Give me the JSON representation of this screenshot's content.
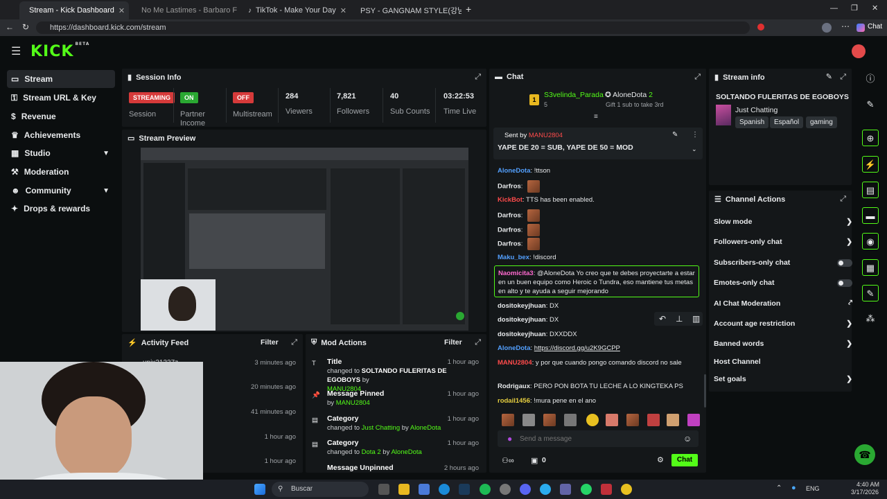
{
  "browser": {
    "tabs": [
      {
        "label": "Stream - Kick Dashboard",
        "active": true
      },
      {
        "label": "No Me Lastimes - Barbaro Fines y"
      },
      {
        "label": "TikTok - Make Your Day"
      },
      {
        "label": "PSY - GANGNAM STYLE(강남스타"
      }
    ],
    "url": "https://dashboard.kick.com/stream",
    "chat_label": "Chat"
  },
  "brand": {
    "logo": "KICK",
    "beta": "BETA",
    "accent": "#53fc18"
  },
  "sidebar": {
    "items": [
      {
        "label": "Stream",
        "icon": "stream-icon"
      },
      {
        "label": "Stream URL & Key",
        "icon": "key-icon"
      },
      {
        "label": "Revenue",
        "icon": "dollar-icon"
      },
      {
        "label": "Achievements",
        "icon": "trophy-icon"
      },
      {
        "label": "Studio",
        "icon": "studio-icon"
      },
      {
        "label": "Moderation",
        "icon": "gavel-icon"
      },
      {
        "label": "Community",
        "icon": "people-icon"
      },
      {
        "label": "Drops & rewards",
        "icon": "gift-icon"
      }
    ]
  },
  "session": {
    "title": "Session Info",
    "stats": [
      {
        "value": "STREAMING",
        "label": "Session"
      },
      {
        "value": "ON",
        "label": "Partner Income"
      },
      {
        "value": "OFF",
        "label": "Multistream"
      },
      {
        "value": "284",
        "label": "Viewers"
      },
      {
        "value": "7,821",
        "label": "Followers"
      },
      {
        "value": "40",
        "label": "Sub Counts"
      },
      {
        "value": "03:22:53",
        "label": "Time Live"
      }
    ]
  },
  "preview": {
    "title": "Stream Preview"
  },
  "activity": {
    "title": "Activity Feed",
    "filter": "Filter",
    "items": [
      {
        "user": "unix21337z",
        "time": "3 minutes ago"
      },
      {
        "time": "20 minutes ago"
      },
      {
        "time": "41 minutes ago"
      },
      {
        "time": "1 hour ago"
      },
      {
        "time": "1 hour ago"
      }
    ]
  },
  "modactions": {
    "title": "Mod Actions",
    "filter": "Filter",
    "items": [
      {
        "title": "Title",
        "pre": "changed to",
        "value": "SOLTANDO FULERITAS DE EGOBOYS",
        "by": "by",
        "user": "MANU2804",
        "time": "1 hour ago"
      },
      {
        "title": "Message Pinned",
        "pre": "",
        "value": "",
        "by": "by",
        "user": "MANU2804",
        "time": "1 hour ago"
      },
      {
        "title": "Category",
        "pre": "changed to",
        "value": "Just Chatting",
        "by": "by",
        "user": "AloneDota",
        "time": "1 hour ago"
      },
      {
        "title": "Category",
        "pre": "changed to",
        "value": "Dota 2",
        "by": "by",
        "user": "AloneDota",
        "time": "1 hour ago"
      },
      {
        "title": "Message Unpinned",
        "pre": "",
        "value": "",
        "by": "",
        "user": "",
        "time": "2 hours ago"
      }
    ]
  },
  "chat": {
    "title": "Chat",
    "top_gifter": {
      "rank": "1",
      "name": "S3velinda_Parada",
      "count": "5"
    },
    "second": {
      "name": "AloneDota",
      "count": "2",
      "note": "Gift 1 sub to take 3rd"
    },
    "pinned": {
      "sent_by": "Sent by",
      "user": "MANU2804",
      "text": "YAPE DE 20 = SUB, YAPE DE 50 = MOD"
    },
    "messages": [
      {
        "user": "AloneDota",
        "color": "#53a0ff",
        "text": "!ttson"
      },
      {
        "user": "Darfros",
        "color": "#e8eaec",
        "text": "",
        "emote": true
      },
      {
        "user": "KickBot",
        "color": "#ff4b4b",
        "text": "TTS has been enabled."
      },
      {
        "user": "Darfros",
        "color": "#e8eaec",
        "text": "",
        "emote": true
      },
      {
        "user": "Darfros",
        "color": "#e8eaec",
        "text": "",
        "emote": true
      },
      {
        "user": "Darfros",
        "color": "#e8eaec",
        "text": "",
        "emote": true
      },
      {
        "user": "Maku_bex",
        "color": "#53a0ff",
        "text": "!discord"
      },
      {
        "user": "dositokeyjhuan",
        "color": "#e8eaec",
        "text": "DX"
      },
      {
        "user": "dositokeyjhuan",
        "color": "#e8eaec",
        "text": "DX"
      },
      {
        "user": "dositokeyjhuan",
        "color": "#e8eaec",
        "text": "DXXDDX"
      },
      {
        "user": "AloneDota",
        "color": "#53a0ff",
        "text": "https://discord.gg/u2K9GCPP"
      },
      {
        "user": "MANU2804",
        "color": "#ff4b4b",
        "text": "y por que cuando pongo comando discord no sale"
      },
      {
        "user": "Rodrigaux",
        "color": "#e8eaec",
        "text": "PERO PON BOTA TU LECHE A LO KINGTEKA PS"
      },
      {
        "user": "rodail1456",
        "color": "#e8d040",
        "text": "!mura pene en el ano"
      }
    ],
    "highlight": {
      "user": "Naomicita3",
      "text": "@AloneDota Yo creo que te debes proyectarte a estar en un buen equipo como Heroic o Tundra, eso mantiene tus metas en alto y te ayuda a seguir mejorando"
    },
    "input_placeholder": "Send a message",
    "points": "0",
    "send_label": "Chat"
  },
  "streaminfo": {
    "title": "Stream info",
    "stream_title": "SOLTANDO FULERITAS DE EGOBOYS",
    "category": "Just Chatting",
    "tags": [
      "Spanish",
      "Español",
      "gaming"
    ]
  },
  "channel_actions": {
    "title": "Channel Actions",
    "items": [
      {
        "label": "Slow mode",
        "control": "chevron"
      },
      {
        "label": "Followers-only chat",
        "control": "chevron"
      },
      {
        "label": "Subscribers-only chat",
        "control": "toggle"
      },
      {
        "label": "Emotes-only chat",
        "control": "toggle"
      },
      {
        "label": "AI Chat Moderation",
        "control": "link"
      },
      {
        "label": "Account age restriction",
        "control": "chevron"
      },
      {
        "label": "Banned words",
        "control": "chevron"
      },
      {
        "label": "Host Channel",
        "control": "none"
      },
      {
        "label": "Set goals",
        "control": "chevron"
      }
    ]
  },
  "taskbar": {
    "search": "Buscar",
    "lang": "ENG",
    "time": "4:40 AM",
    "date": "3/17/2026"
  }
}
